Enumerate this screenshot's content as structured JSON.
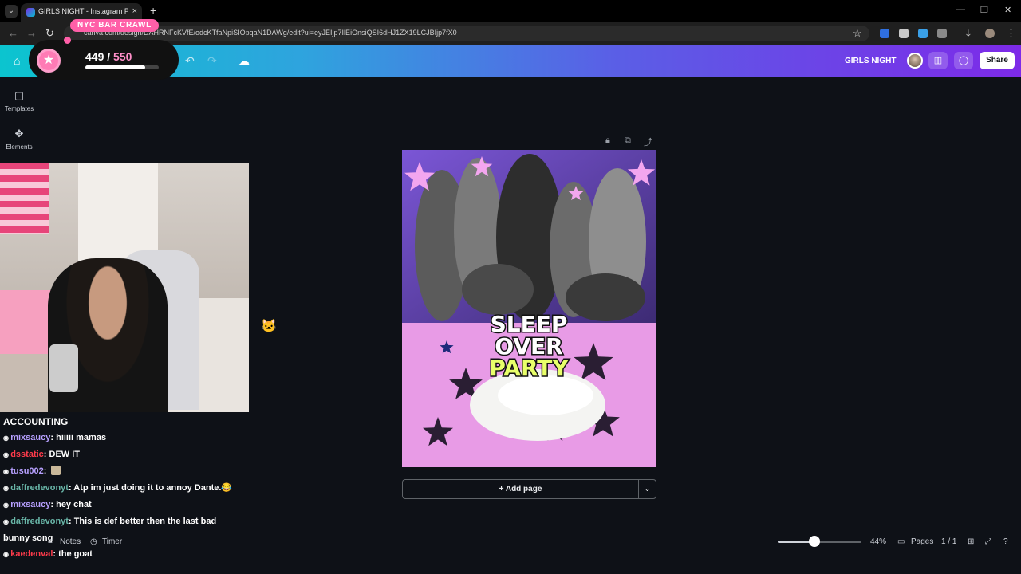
{
  "browser": {
    "tab_title": "GIRLS NIGHT - Instagram Post",
    "url": "canva.com/design/DAHRNFcKVfE/odcKTfaNpiSIOpqaN1DAWg/edit?ui=eyJEIjp7IlEiOnsiQSI6dHJ1ZX19LCJBIjp7fX0"
  },
  "canva": {
    "doc_title": "GIRLS NIGHT",
    "share_label": "Share",
    "side_panel": [
      {
        "label": "Templates",
        "icon": "templates-icon"
      },
      {
        "label": "Elements",
        "icon": "elements-icon"
      }
    ],
    "add_page_label": "+ Add page",
    "footer": {
      "notes_label": "Notes",
      "timer_label": "Timer",
      "zoom_label": "44%",
      "zoom_fraction": 0.44,
      "pages_label": "Pages",
      "page_count": "1 / 1"
    }
  },
  "design": {
    "title_line1": "SLEEP",
    "title_line2": "OVER",
    "title_line3": "PARTY",
    "colors": {
      "photo_purple": "#6a45c2",
      "bottom_pink": "#e89be6",
      "star_pink": "#f3a6ef",
      "star_dark": "#2a1e33",
      "star_blue": "#1e2a7a",
      "party_yellow": "#e9ff6a"
    }
  },
  "stream": {
    "goal": {
      "label": "NYC BAR CRAWL",
      "current": "449",
      "separator": " / ",
      "target": "550",
      "progress": 0.816
    },
    "chat_title": "ACCOUNTING",
    "chat": [
      {
        "user": "mixsaucy",
        "text": "hiiiii mamas",
        "color": "u-mix"
      },
      {
        "user": "dsstatic",
        "text": "DEW IT",
        "color": "u-ds"
      },
      {
        "user": "tusu002",
        "text": "",
        "color": "u-tusu"
      },
      {
        "user": "daffredevonyt",
        "text": "Atp im just doing it to annoy Dante.😂",
        "color": "u-daf"
      },
      {
        "user": "mixsaucy",
        "text": "hey chat",
        "color": "u-mix"
      },
      {
        "user": "daffredevonyt",
        "text": "This is def better then the last bad bunny song",
        "color": "u-daf"
      },
      {
        "user": "kaedenval",
        "text": "the goat",
        "color": "u-kae"
      }
    ]
  }
}
